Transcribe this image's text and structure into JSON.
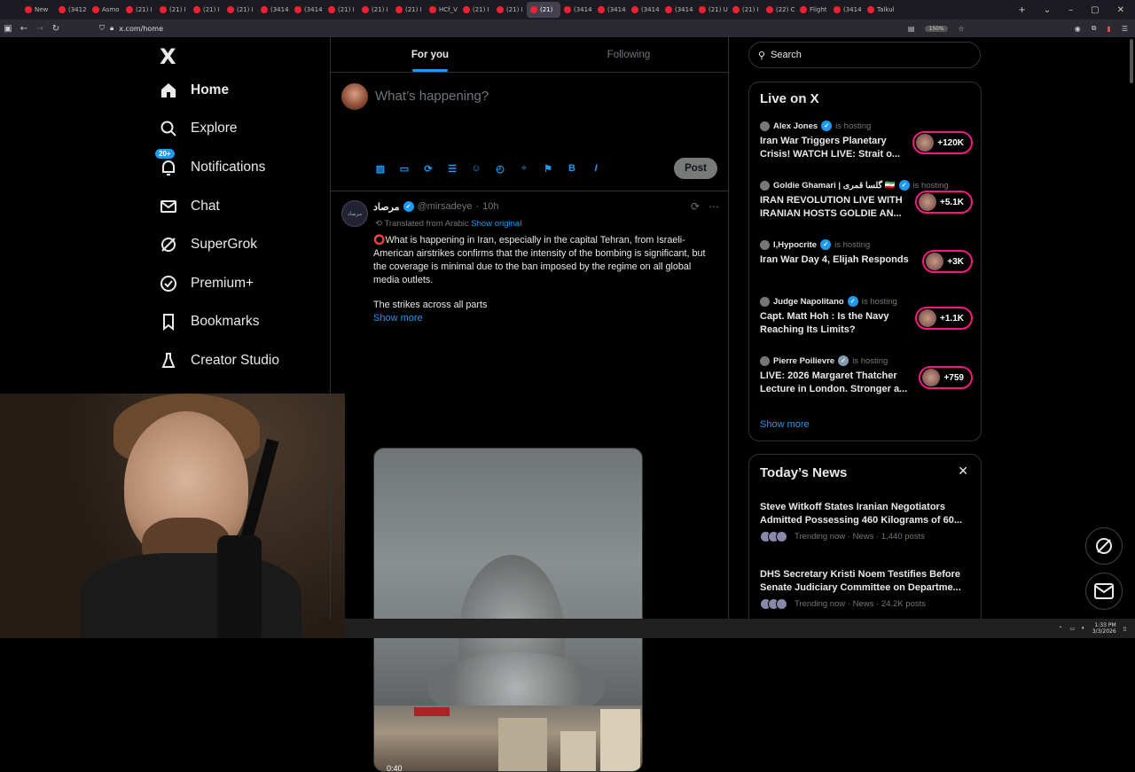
{
  "browser": {
    "tabs": [
      "New",
      "(3412",
      "Asmo",
      "(21) I",
      "(21) I",
      "(21) I",
      "(21) I",
      "(3414",
      "(3414",
      "(21) I",
      "(21) I",
      "(21) I",
      "HCf_V",
      "(21) I",
      "(21) I",
      "(21)",
      "(3414",
      "(3414",
      "(3414",
      "(3414",
      "(21) U",
      "(21) I",
      "(22) C",
      "Flight",
      "(3414",
      "Talkul"
    ],
    "url": "x.com/home",
    "zoom": "150%"
  },
  "nav": {
    "logo": "X",
    "items": [
      {
        "label": "Home",
        "icon": "home-icon"
      },
      {
        "label": "Explore",
        "icon": "search-icon"
      },
      {
        "label": "Notifications",
        "icon": "bell-icon",
        "badge": "20+"
      },
      {
        "label": "Chat",
        "icon": "mail-icon"
      },
      {
        "label": "SuperGrok",
        "icon": "grok-icon"
      },
      {
        "label": "Premium+",
        "icon": "verified-icon"
      },
      {
        "label": "Bookmarks",
        "icon": "bookmark-icon"
      },
      {
        "label": "Creator Studio",
        "icon": "flask-icon"
      }
    ]
  },
  "feed": {
    "tabs": [
      "For you",
      "Following"
    ],
    "compose_placeholder": "What’s happening?",
    "post_label": "Post",
    "compose_tools": [
      "image-icon",
      "gif-icon",
      "grok-icon",
      "poll-icon",
      "emoji-icon",
      "schedule-icon",
      "location-icon",
      "flag-icon",
      "B",
      "I"
    ]
  },
  "tweet": {
    "name": "مرصاد",
    "handle": "@mirsadeye",
    "time": "10h",
    "avatar_text": "مرصاد",
    "translated_label": "Translated from Arabic",
    "show_original": "Show original",
    "text": "⭕What is happening in Iran, especially in the capital Tehran, from Israeli-American airstrikes confirms that the intensity of the bombing is significant, but the coverage is minimal due to the ban imposed by the regime on all global media outlets.",
    "text_2": "The strikes across all parts",
    "show_more": "Show more",
    "media_timestamp": "0:40"
  },
  "sidebar": {
    "search_placeholder": "Search",
    "live": {
      "title": "Live on X",
      "items": [
        {
          "host": "Alex Jones",
          "status": "is hosting",
          "title": "Iran War Triggers Planetary Crisis! WATCH LIVE: Strait o...",
          "count": "+120K",
          "verified": "blue"
        },
        {
          "host": "Goldie Ghamari | گلسا قمری 🇮🇷",
          "status": "is hosting",
          "title": "IRAN REVOLUTION LIVE WITH IRANIAN HOSTS GOLDIE AN...",
          "count": "+5.1K",
          "verified": "blue"
        },
        {
          "host": "I,Hypocrite",
          "status": "is hosting",
          "title": "Iran War Day 4, Elijah Responds",
          "count": "+3K",
          "verified": "blue"
        },
        {
          "host": "Judge Napolitano",
          "status": "is hosting",
          "title": "Capt. Matt Hoh : Is the Navy Reaching Its Limits?",
          "count": "+1.1K",
          "verified": "blue"
        },
        {
          "host": "Pierre Poilievre",
          "status": "is hosting",
          "title": "LIVE: 2026 Margaret Thatcher Lecture in London. Stronger a...",
          "count": "+759",
          "verified": "grey"
        }
      ],
      "show_more": "Show more"
    },
    "news": {
      "title": "Today’s News",
      "items": [
        {
          "title": "Steve Witkoff States Iranian Negotiators Admitted Possessing 460 Kilograms of 60...",
          "meta": "Trending now · News · 1,440 posts"
        },
        {
          "title": "DHS Secretary Kristi Noem Testifies Before Senate Judiciary Committee on Departme...",
          "meta": "Trending now · News · 24.2K posts"
        }
      ]
    }
  },
  "taskbar": {
    "time": "1:33 PM",
    "date": "3/3/2026"
  },
  "colors": {
    "accent": "#1d9bf0",
    "live_ring": "#f91880",
    "border": "#2f3336",
    "muted": "#71767b"
  }
}
